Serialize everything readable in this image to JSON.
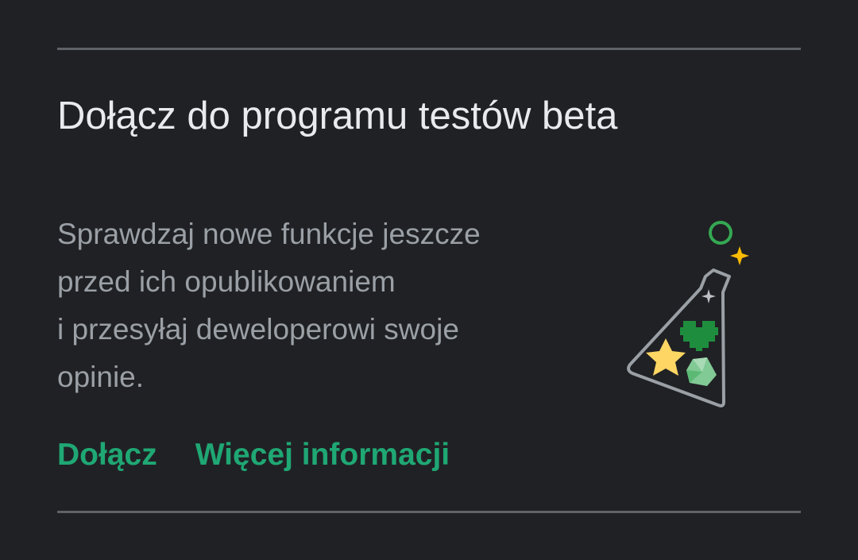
{
  "card": {
    "title": "Dołącz do programu testów beta",
    "description_lines": [
      "Sprawdzaj nowe funkcje jeszcze",
      "przed ich opublikowaniem",
      "i przesyłaj deweloperowi swoje",
      "opinie."
    ],
    "actions": {
      "join_label": "Dołącz",
      "more_info_label": "Więcej informacji"
    },
    "illustration": {
      "icon": "beta-flask-icon",
      "flask_outline_color": "#9aa0a6",
      "circle_color": "#34a853",
      "sparkle_color": "#fbbc04",
      "small_sparkle_color": "#bdc1c6",
      "heart_color": "#1e8e3e",
      "star_color": "#fdd663",
      "gem_color": "#81c995"
    }
  },
  "colors": {
    "background": "#202124",
    "title": "#e8eaed",
    "body_text": "#9aa0a6",
    "accent": "#1fa774",
    "divider": "#5f6368"
  }
}
